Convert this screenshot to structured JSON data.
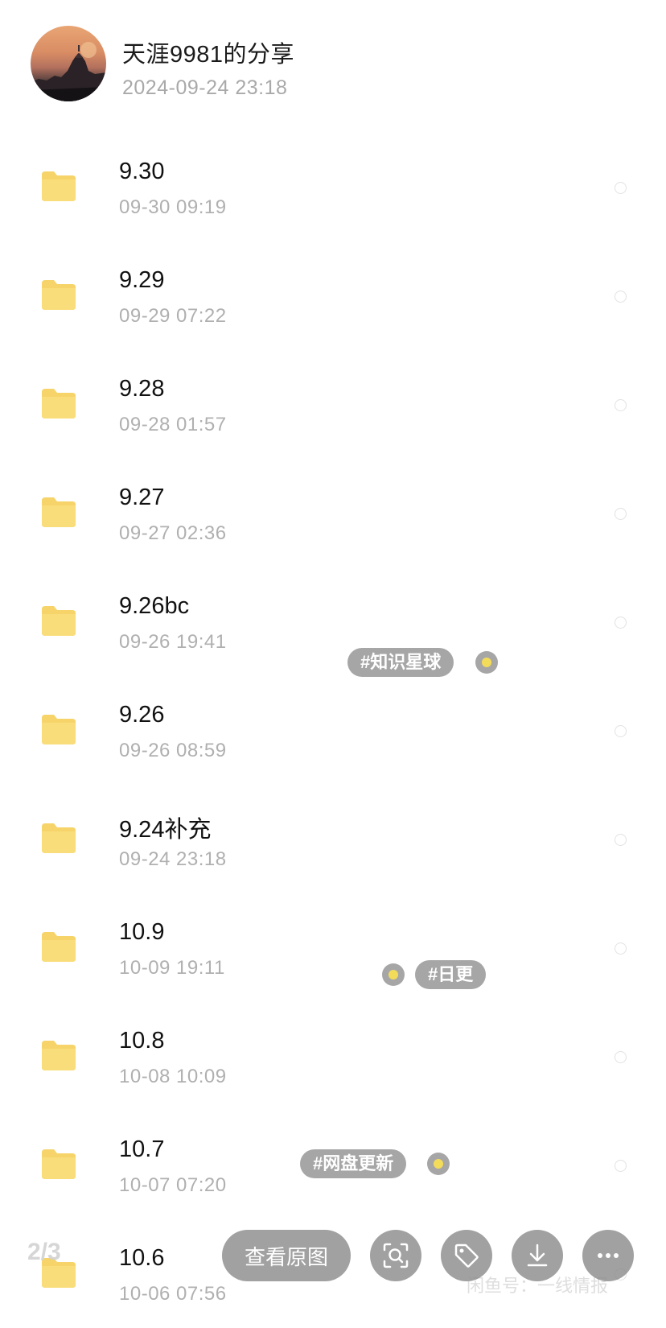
{
  "header": {
    "title": "天涯9981的分享",
    "time": "2024-09-24  23:18"
  },
  "files": [
    {
      "name": "9.30",
      "time": "09-30  09:19"
    },
    {
      "name": "9.29",
      "time": "09-29  07:22"
    },
    {
      "name": "9.28",
      "time": "09-28  01:57"
    },
    {
      "name": "9.27",
      "time": "09-27  02:36"
    },
    {
      "name": "9.26bc",
      "time": "09-26  19:41"
    },
    {
      "name": "9.26",
      "time": "09-26  08:59"
    },
    {
      "name": "9.24补充",
      "time": "09-24  23:18"
    },
    {
      "name": "10.9",
      "time": "10-09  19:11"
    },
    {
      "name": "10.8",
      "time": "10-08  10:09"
    },
    {
      "name": "10.7",
      "time": "10-07  07:20"
    },
    {
      "name": "10.6",
      "time": "10-06  07:56"
    }
  ],
  "tags": {
    "knowledge_planet": "#知识星球",
    "daily_update": "#日更",
    "netdisk_update": "#网盘更新"
  },
  "viewer": {
    "page_indicator": "2/3",
    "view_original_label": "查看原图",
    "watermark": "闲鱼号：一线情报"
  },
  "colors": {
    "folder": "#f7d46a",
    "tag_dot": "#f3dc5a",
    "toolbar_bg": "#8c8c8c"
  },
  "icons": {
    "lens": "scan-search-icon",
    "tag": "tag-icon",
    "download": "download-icon",
    "more": "more-icon"
  }
}
